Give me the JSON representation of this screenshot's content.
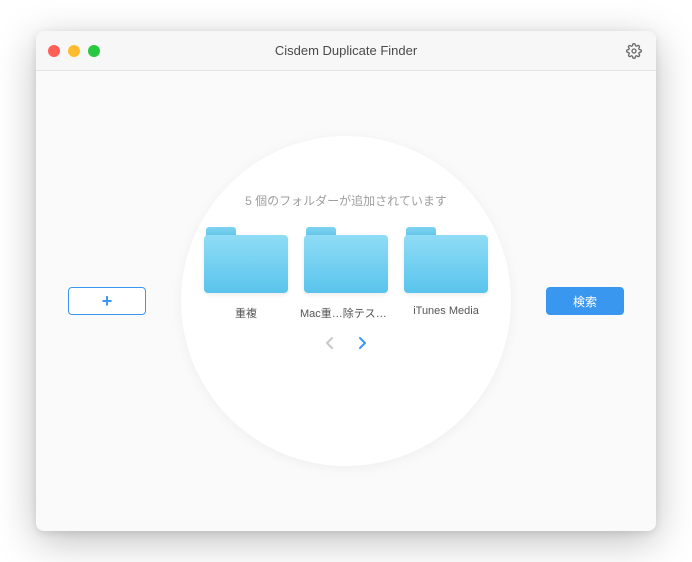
{
  "window": {
    "title": "Cisdem Duplicate Finder"
  },
  "status": {
    "text": "5 個のフォルダーが追加されています"
  },
  "folders": [
    {
      "label": "重複"
    },
    {
      "label": "Mac重…除テスト用"
    },
    {
      "label": "iTunes Media"
    }
  ],
  "buttons": {
    "search": "検索"
  },
  "icons": {
    "gear": "gear-icon",
    "plus": "plus-icon",
    "chev_left": "chevron-left-icon",
    "chev_right": "chevron-right-icon"
  },
  "pager": {
    "prev_enabled": false,
    "next_enabled": true
  }
}
